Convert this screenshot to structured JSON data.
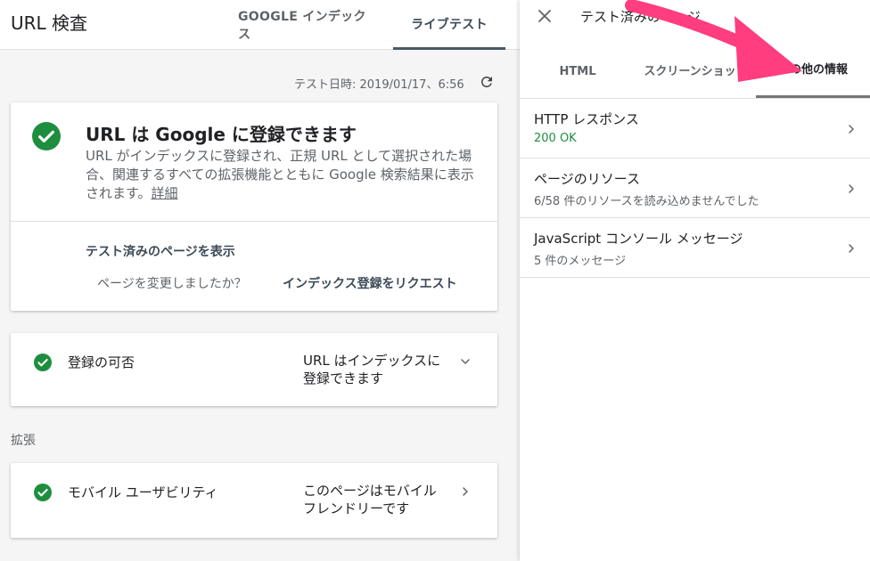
{
  "header": {
    "title": "URL 検査",
    "tabs": [
      {
        "label": "GOOGLE インデックス"
      },
      {
        "label": "ライブテスト"
      }
    ]
  },
  "test_date": "テスト日時: 2019/01/17、6:56",
  "main_card": {
    "heading": "URL は Google に登録できます",
    "description": "URL がインデックスに登録され、正規 URL として選択された場合、関連するすべての拡張機能とともに Google 検索結果に表示されます。",
    "details_link": "詳細",
    "view_tested_page": "テスト済みのページを表示",
    "changed_question": "ページを変更しましたか？",
    "request_indexing": "インデックス登録をリクエスト"
  },
  "registration_card": {
    "label": "登録の可否",
    "value": "URL はインデックスに登録できます"
  },
  "enhancements": {
    "section_label": "拡張",
    "mobile": {
      "label": "モバイル ユーザビリティ",
      "value": "このページはモバイル フレンドリーです"
    }
  },
  "panel": {
    "title": "テスト済みのページ",
    "tabs": [
      {
        "label": "HTML"
      },
      {
        "label": "スクリーンショット"
      },
      {
        "label": "その他の情報"
      }
    ],
    "items": [
      {
        "title": "HTTP レスポンス",
        "subtitle": "200 OK"
      },
      {
        "title": "ページのリソース",
        "subtitle": "6/58 件のリソースを読み込めませんでした"
      },
      {
        "title": "JavaScript コンソール メッセージ",
        "subtitle": "5 件のメッセージ"
      }
    ]
  },
  "colors": {
    "success_green": "#1e8e3e",
    "annotation_arrow": "#ff3d7f",
    "tab_accent": "#455a64"
  }
}
